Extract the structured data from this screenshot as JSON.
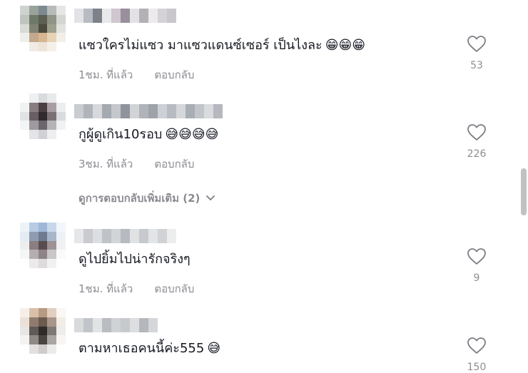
{
  "comments": [
    {
      "text": "แซวใครไม่แซว มาแซวแดนซ์เซอร์ เป็นไงละ",
      "emojis": "😁😁😁",
      "time": "1ชม. ที่แล้ว",
      "reply_label": "ตอบกลับ",
      "likes": "53"
    },
    {
      "text": "กูผู้ดูเกิน10รอบ",
      "emojis": "😅😅😅😅",
      "time": "3ชม. ที่แล้ว",
      "reply_label": "ตอบกลับ",
      "likes": "226"
    },
    {
      "text": "ดูไปยิ้มไปน่ารักจริงๆ",
      "emojis": "",
      "time": "1ชม. ที่แล้ว",
      "reply_label": "ตอบกลับ",
      "likes": "9"
    },
    {
      "text": "ตามหาเธอคนนี้ค่ะ555",
      "emojis": "😅",
      "time": "",
      "reply_label": "",
      "likes": "150"
    }
  ],
  "more_replies": {
    "label": "ดูการตอบกลับเพิ่มเติม (2)"
  },
  "icons": {
    "like": "heart-outline-icon",
    "expand": "chevron-down-icon"
  },
  "colors": {
    "primary_text": "#161823",
    "secondary_text": "#8a8b91",
    "scrollbar": "#c1c1c1"
  }
}
